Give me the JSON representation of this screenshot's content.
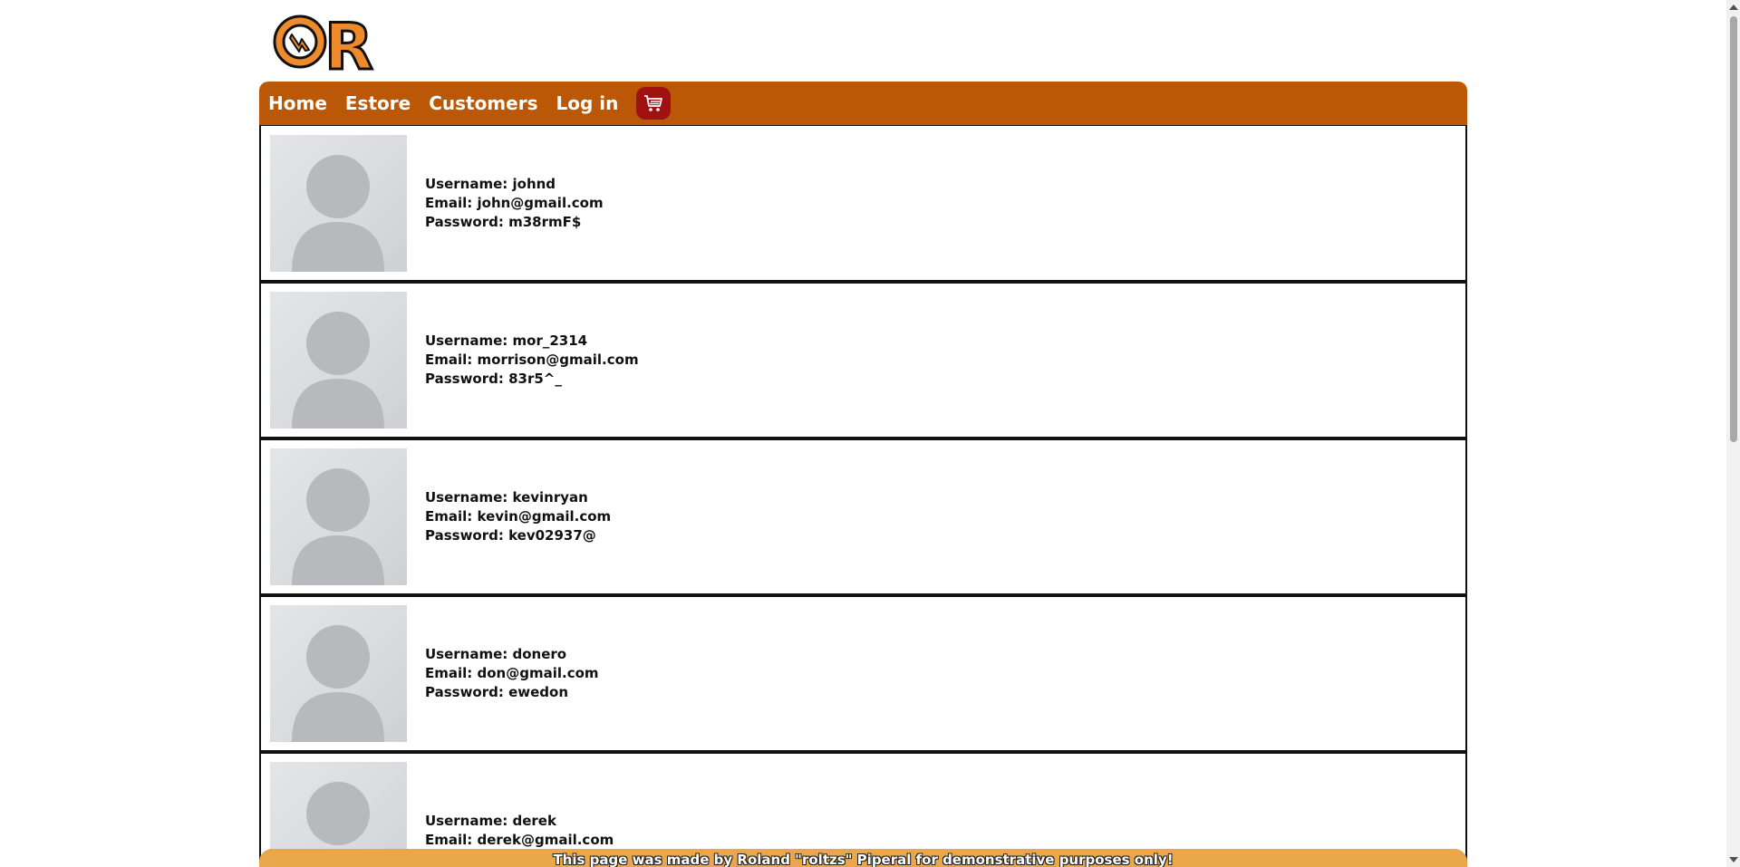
{
  "logo": {
    "letter": "R"
  },
  "nav": {
    "items": [
      {
        "label": "Home"
      },
      {
        "label": "Estore"
      },
      {
        "label": "Customers"
      },
      {
        "label": "Log in"
      }
    ],
    "cart_icon": "cart-icon"
  },
  "customers": [
    {
      "username_label": "Username: johnd",
      "email_label": "Email: john@gmail.com",
      "password_label": "Password: m38rmF$"
    },
    {
      "username_label": "Username: mor_2314",
      "email_label": "Email: morrison@gmail.com",
      "password_label": "Password: 83r5^_"
    },
    {
      "username_label": "Username: kevinryan",
      "email_label": "Email: kevin@gmail.com",
      "password_label": "Password: kev02937@"
    },
    {
      "username_label": "Username: donero",
      "email_label": "Email: don@gmail.com",
      "password_label": "Password: ewedon"
    },
    {
      "username_label": "Username: derek",
      "email_label": "Email: derek@gmail.com",
      "password_label": ""
    }
  ],
  "footer": {
    "text": "This page was made by Roland \"roltzs\" Piperal for demonstrative purposes only!"
  },
  "colors": {
    "nav_bg": "#bb5808",
    "cart_bg": "#a01212",
    "footer_bg": "#e9a64a",
    "logo_orange": "#ee8a2c"
  }
}
